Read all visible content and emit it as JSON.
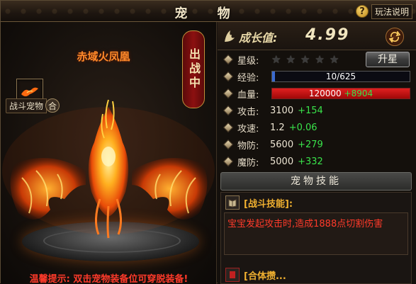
{
  "window": {
    "title": "宠 物",
    "help_label": "玩法说明"
  },
  "pet": {
    "name": "赤域火凤凰",
    "status": "出战中",
    "battle_label": "战斗宠物",
    "merge_label": "合",
    "tip": "温馨提示: 双击宠物装备位可穿脱装备!"
  },
  "growth": {
    "label": "成长值:",
    "value": "4.99"
  },
  "stats": {
    "star_label": "星级:",
    "stars_filled": 0,
    "stars_total": 5,
    "upgrade_label": "升星",
    "exp_label": "经验:",
    "exp_text": "10/625",
    "exp_fraction": 0.016,
    "hp_label": "血量:",
    "hp_value": "120000",
    "hp_bonus": "+8904",
    "attack_label": "攻击:",
    "attack_value": "3100",
    "attack_bonus": "+154",
    "speed_label": "攻速:",
    "speed_value": "1.2",
    "speed_bonus": "+0.06",
    "pdef_label": "物防:",
    "pdef_value": "5600",
    "pdef_bonus": "+279",
    "mdef_label": "魔防:",
    "mdef_value": "5000",
    "mdef_bonus": "+332"
  },
  "skills": {
    "header": "宠物技能",
    "battle_skill_title": "[战斗技能]:",
    "battle_skill_desc": "宝宝发起攻击时,造成1888点切割伤害",
    "combo_skill_title": "[合体攒..."
  },
  "colors": {
    "bonus_green": "#39e34a",
    "hp_red": "#c01010",
    "exp_blue": "#3a6ad0",
    "tip_red": "#ff3a2a"
  }
}
